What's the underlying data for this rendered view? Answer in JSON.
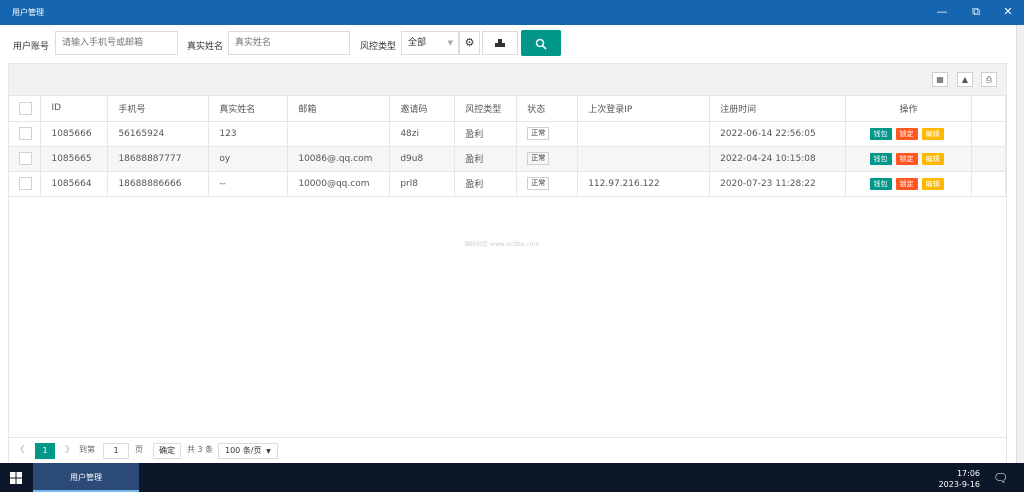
{
  "window": {
    "title": "用户管理"
  },
  "filters": {
    "account_label": "用户账号",
    "account_placeholder": "请输入手机号或邮箱",
    "realname_label": "真实姓名",
    "realname_placeholder": "真实姓名",
    "risk_label": "风控类型",
    "risk_selected": "全部"
  },
  "table": {
    "headers": [
      "ID",
      "手机号",
      "真实姓名",
      "邮箱",
      "邀请码",
      "风控类型",
      "状态",
      "上次登录IP",
      "注册时间",
      "操作"
    ],
    "rows": [
      {
        "id": "1085666",
        "phone": "56165924",
        "name": "123",
        "email": "",
        "invite": "48zi",
        "risk": "盈利",
        "status": "正常",
        "ip": "",
        "time": "2022-06-14 22:56:05"
      },
      {
        "id": "1085665",
        "phone": "18688887777",
        "name": "oy",
        "email": "10086@.qq.com",
        "invite": "d9u8",
        "risk": "盈利",
        "status": "正常",
        "ip": "",
        "time": "2022-04-24 10:15:08"
      },
      {
        "id": "1085664",
        "phone": "18688886666",
        "name": "--",
        "email": "10000@qq.com",
        "invite": "prl8",
        "risk": "盈利",
        "status": "正常",
        "ip": "112.97.216.122",
        "time": "2020-07-23 11:28:22"
      }
    ],
    "actions": {
      "wallet": "钱包",
      "lock": "锁定",
      "edit": "编辑"
    }
  },
  "watermark": "源码社区 www.ecitba.com",
  "pager": {
    "current": "1",
    "goto_label": "到第",
    "goto_value": "1",
    "page_unit": "页",
    "confirm": "确定",
    "total": "共 3 条",
    "page_size": "100 条/页"
  },
  "taskbar": {
    "app": "用户管理",
    "time": "17:06",
    "date": "2023-9-16"
  },
  "colors": {
    "titlebar": "#1565b0",
    "primary": "#009688",
    "danger": "#ff5722",
    "warn": "#ffb800",
    "taskbar": "#0c1729"
  }
}
